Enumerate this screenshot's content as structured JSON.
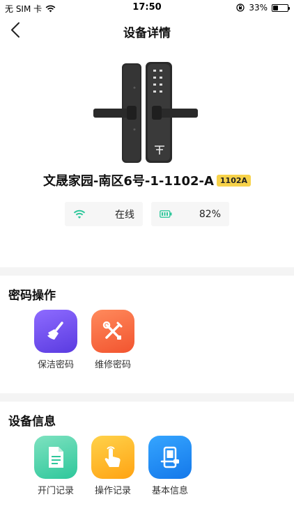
{
  "status_bar": {
    "carrier": "无 SIM 卡",
    "time": "17:50",
    "battery": "33%",
    "battery_fraction": 0.33
  },
  "nav": {
    "title": "设备详情",
    "back_icon": "chevron-left-icon"
  },
  "device": {
    "name": "文晟家园-南区6号-1-1102-A",
    "room_badge": "1102A",
    "online_status": "在线",
    "battery_level": "82%",
    "online_icon": "wifi-icon",
    "battery_icon": "battery-icon"
  },
  "sections": {
    "password_ops": {
      "title": "密码操作",
      "items": [
        {
          "label": "保洁密码",
          "icon": "broom-icon"
        },
        {
          "label": "维修密码",
          "icon": "tools-icon"
        }
      ]
    },
    "device_info": {
      "title": "设备信息",
      "items": [
        {
          "label": "开门记录",
          "icon": "document-icon"
        },
        {
          "label": "操作记录",
          "icon": "tap-hand-icon"
        },
        {
          "label": "基本信息",
          "icon": "device-info-icon"
        }
      ]
    }
  },
  "colors": {
    "accent_green": "#2ec79b",
    "badge_yellow": "#f7d24a"
  }
}
